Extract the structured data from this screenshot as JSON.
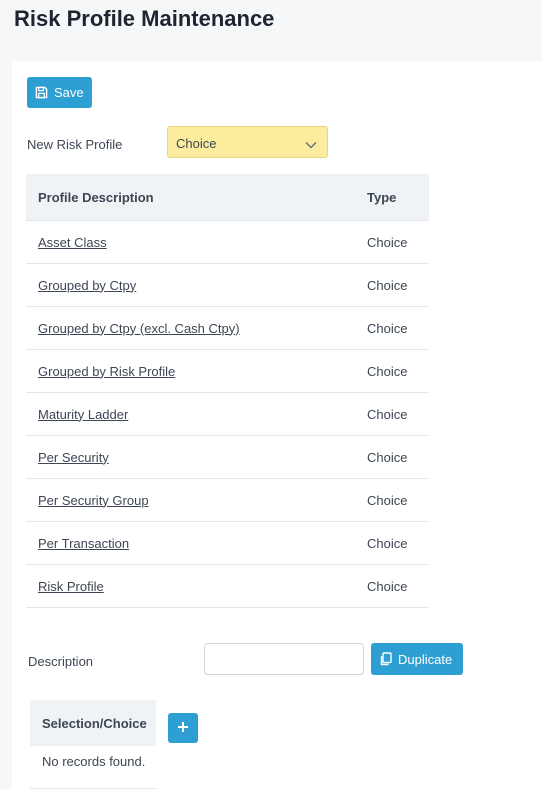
{
  "page": {
    "title": "Risk Profile Maintenance"
  },
  "toolbar": {
    "save_label": "Save"
  },
  "new_profile": {
    "label": "New Risk Profile",
    "selected": "Choice"
  },
  "profiles_table": {
    "headers": {
      "description": "Profile Description",
      "type": "Type"
    },
    "rows": [
      {
        "description": "Asset Class",
        "type": "Choice"
      },
      {
        "description": "Grouped by Ctpy",
        "type": "Choice"
      },
      {
        "description": "Grouped by Ctpy (excl. Cash Ctpy)",
        "type": "Choice"
      },
      {
        "description": "Grouped by Risk Profile",
        "type": "Choice"
      },
      {
        "description": "Maturity Ladder",
        "type": "Choice"
      },
      {
        "description": "Per Security",
        "type": "Choice"
      },
      {
        "description": "Per Security Group",
        "type": "Choice"
      },
      {
        "description": "Per Transaction",
        "type": "Choice"
      },
      {
        "description": "Risk Profile",
        "type": "Choice"
      }
    ]
  },
  "description_form": {
    "label": "Description",
    "value": "",
    "duplicate_label": "Duplicate"
  },
  "selection_table": {
    "header": "Selection/Choice",
    "empty_text": "No records found."
  },
  "colors": {
    "accent": "#2d9fd3",
    "select_bg": "#fcec9e",
    "header_bg": "#f0f3f6"
  }
}
